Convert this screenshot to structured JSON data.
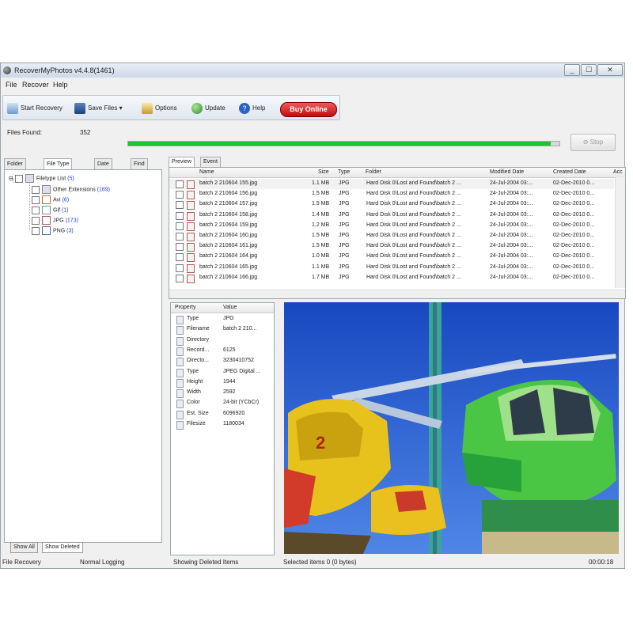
{
  "window": {
    "title": "RecoverMyPhotos v4.4.8(1461)",
    "min": "_",
    "max": "☐",
    "close": "✕"
  },
  "menu": [
    "File",
    "Recover",
    "Help"
  ],
  "toolbar": {
    "start_recovery": "Start Recovery",
    "save_files": "Save Files",
    "options": "Options",
    "update": "Update",
    "help": "Help",
    "buy_online": "Buy Online"
  },
  "files_found_label": "Files Found:",
  "files_found_value": "352",
  "progress_fraction": 0.98,
  "stop_label": "Stop",
  "left_tabs": [
    "Folder",
    "File Type",
    "Date",
    "Find"
  ],
  "tree": {
    "root": "Filetype List",
    "root_count": "(5)",
    "items": [
      {
        "name": "Other Extensions",
        "count": "(169)"
      },
      {
        "name": "Avi",
        "count": "(6)"
      },
      {
        "name": "Gif",
        "count": "(1)"
      },
      {
        "name": "JPG",
        "count": "(173)"
      },
      {
        "name": "PNG",
        "count": "(3)"
      }
    ]
  },
  "left_bottom": {
    "show_all": "Show All",
    "show_deleted": "Show Deleted"
  },
  "right_tabs": [
    "Preview",
    "Event Log"
  ],
  "grid": {
    "columns": [
      "Name",
      "Size",
      "Type",
      "Folder",
      "Modified Date",
      "Created Date",
      "Acc"
    ],
    "rows": [
      {
        "name": "batch 2 210604 155.jpg",
        "size": "1.1 MB",
        "type": "JPG",
        "folder": "Hard Disk 0\\Lost and Found\\batch 2 ...",
        "modified": "24-Jul-2004 03:...",
        "created": "02-Dec-2010 0..."
      },
      {
        "name": "batch 2 210604 156.jpg",
        "size": "1.5 MB",
        "type": "JPG",
        "folder": "Hard Disk 0\\Lost and Found\\batch 2 ...",
        "modified": "24-Jul-2004 03:...",
        "created": "02-Dec-2010 0..."
      },
      {
        "name": "batch 2 210604 157.jpg",
        "size": "1.5 MB",
        "type": "JPG",
        "folder": "Hard Disk 0\\Lost and Found\\batch 2 ...",
        "modified": "24-Jul-2004 03:...",
        "created": "02-Dec-2010 0..."
      },
      {
        "name": "batch 2 210604 158.jpg",
        "size": "1.4 MB",
        "type": "JPG",
        "folder": "Hard Disk 0\\Lost and Found\\batch 2 ...",
        "modified": "24-Jul-2004 03:...",
        "created": "02-Dec-2010 0..."
      },
      {
        "name": "batch 2 210604 159.jpg",
        "size": "1.2 MB",
        "type": "JPG",
        "folder": "Hard Disk 0\\Lost and Found\\batch 2 ...",
        "modified": "24-Jul-2004 03:...",
        "created": "02-Dec-2010 0..."
      },
      {
        "name": "batch 2 210604 160.jpg",
        "size": "1.5 MB",
        "type": "JPG",
        "folder": "Hard Disk 0\\Lost and Found\\batch 2 ...",
        "modified": "24-Jul-2004 03:...",
        "created": "02-Dec-2010 0..."
      },
      {
        "name": "batch 2 210604 161.jpg",
        "size": "1.5 MB",
        "type": "JPG",
        "folder": "Hard Disk 0\\Lost and Found\\batch 2 ...",
        "modified": "24-Jul-2004 03:...",
        "created": "02-Dec-2010 0..."
      },
      {
        "name": "batch 2 210604 164.jpg",
        "size": "1.0 MB",
        "type": "JPG",
        "folder": "Hard Disk 0\\Lost and Found\\batch 2 ...",
        "modified": "24-Jul-2004 03:...",
        "created": "02-Dec-2010 0..."
      },
      {
        "name": "batch 2 210604 165.jpg",
        "size": "1.1 MB",
        "type": "JPG",
        "folder": "Hard Disk 0\\Lost and Found\\batch 2 ...",
        "modified": "24-Jul-2004 03:...",
        "created": "02-Dec-2010 0..."
      },
      {
        "name": "batch 2 210604 166.jpg",
        "size": "1.7 MB",
        "type": "JPG",
        "folder": "Hard Disk 0\\Lost and Found\\batch 2 ...",
        "modified": "24-Jul-2004 03:...",
        "created": "02-Dec-2010 0..."
      }
    ]
  },
  "properties": {
    "headers": [
      "Property",
      "Value"
    ],
    "rows": [
      {
        "key": "Type",
        "value": "JPG"
      },
      {
        "key": "Filename",
        "value": "batch 2 210..."
      },
      {
        "key": "Directory",
        "value": ""
      },
      {
        "key": "Record...",
        "value": "6125"
      },
      {
        "key": "Directo...",
        "value": "3230410752"
      },
      {
        "key": "Type",
        "value": "JPEG Digital ..."
      },
      {
        "key": "Height",
        "value": "1944"
      },
      {
        "key": "Width",
        "value": "2592"
      },
      {
        "key": "Color",
        "value": "24-bit (YCbCr)"
      },
      {
        "key": "Est. Size",
        "value": "6096920"
      },
      {
        "key": "Filesize",
        "value": "1180034"
      }
    ]
  },
  "status": {
    "mode": "File Recovery",
    "logging": "Normal Logging",
    "showing": "Showing Deleted Items",
    "selected": "Selected items 0 (0 bytes)",
    "timer": "00:00:18"
  },
  "colors": {
    "progress": "#1fc32a",
    "buy_online": "#d01414",
    "sky": "#2a5fd8"
  }
}
